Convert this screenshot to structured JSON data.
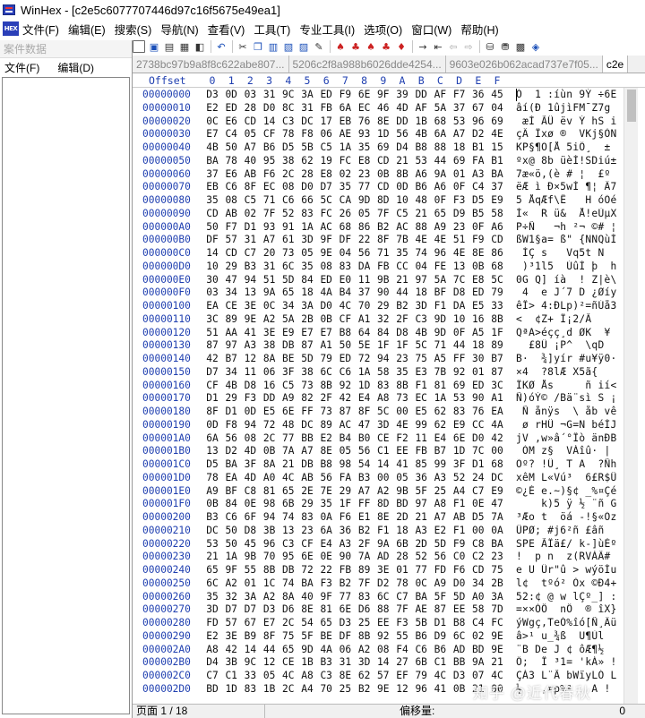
{
  "window": {
    "title": "WinHex - [c2e5c6077707446d97c16f5675e49ea1]",
    "logo_text": "HEX"
  },
  "menu": [
    "文件(F)",
    "编辑(E)",
    "搜索(S)",
    "导航(N)",
    "查看(V)",
    "工具(T)",
    "专业工具(I)",
    "选项(O)",
    "窗口(W)",
    "帮助(H)"
  ],
  "case_panel": {
    "title": "案件数据",
    "menu": [
      "文件(F)",
      "编辑(D)"
    ]
  },
  "tabs": [
    {
      "label": "2738bc97b9a8f8c622abe807...",
      "active": false
    },
    {
      "label": "5206c2f8a988b6026dde4254...",
      "active": false
    },
    {
      "label": "9603e026b062acad737e7f05...",
      "active": false
    },
    {
      "label": "c2e",
      "active": true
    }
  ],
  "hex": {
    "offset_label": "Offset",
    "columns": [
      "0",
      "1",
      "2",
      "3",
      "4",
      "5",
      "6",
      "7",
      "8",
      "9",
      "A",
      "B",
      "C",
      "D",
      "E",
      "F"
    ],
    "rows": [
      {
        "addr": "00000000",
        "bytes": "D3 0D 03 31 9C 3A ED F9 6E 9F 39 DD AF F7 36 45",
        "ascii": "Ó  1 :íùn 9Ý ÷6E"
      },
      {
        "addr": "00000010",
        "bytes": "E2 ED 28 D0 8C 31 FB 6A EC 46 4D AF 5A 37 67 04",
        "ascii": "âí(Ð 1ûjìFM¯Z7g "
      },
      {
        "addr": "00000020",
        "bytes": "0C E6 CD 14 C3 DC 17 EB 76 8E DD 1B 68 53 96 69",
        "ascii": " æÍ ÃÜ ëv Ý hS i"
      },
      {
        "addr": "00000030",
        "bytes": "E7 C4 05 CF 78 F8 06 AE 93 1D 56 4B 6A A7 D2 4E",
        "ascii": "çÄ Ïxø ®  VKj§ÒN"
      },
      {
        "addr": "00000040",
        "bytes": "4B 50 A7 B6 D5 5B C5 1A 35 69 D4 B8 88 18 B1 15",
        "ascii": "KP§¶Õ[Å 5iÔ¸  ± "
      },
      {
        "addr": "00000050",
        "bytes": "BA 78 40 95 38 62 19 FC E8 CD 21 53 44 69 FA B1",
        "ascii": "ºx@ 8b üèÍ!SDiú±"
      },
      {
        "addr": "00000060",
        "bytes": "37 E6 AB F6 2C 28 E8 02 23 0B 8B A6 9A 01 A3 BA",
        "ascii": "7æ«ö,(è # ¦  £º"
      },
      {
        "addr": "00000070",
        "bytes": "EB C6 8F EC 08 D0 D7 35 77 CD 0D B6 A6 0F C4 37",
        "ascii": "ëÆ ì Ð×5wÍ ¶¦ Ä7"
      },
      {
        "addr": "00000080",
        "bytes": "35 08 C5 71 C6 66 5C CA 9D 8D 10 48 0F F3 D5 E9",
        "ascii": "5 ÅqÆf\\Ê   H óÕé"
      },
      {
        "addr": "00000090",
        "bytes": "CD AB 02 7F 52 83 FC 26 05 7F C5 21 65 D9 B5 58",
        "ascii": "Í«  R ü&  Å!eÙµX"
      },
      {
        "addr": "000000A0",
        "bytes": "50 F7 D1 93 91 1A AC 68 86 B2 AC 88 A9 23 0F A6",
        "ascii": "P÷Ñ   ¬h ²¬ ©# ¦"
      },
      {
        "addr": "000000B0",
        "bytes": "DF 57 31 A7 61 3D 9F DF 22 8F 7B 4E 4E 51 F9 CD",
        "ascii": "ßW1§a= ß\" {NNQùÍ"
      },
      {
        "addr": "000000C0",
        "bytes": "14 CD C7 20 73 05 9E 04 56 71 35 74 96 4E 8E 86",
        "ascii": " ÍÇ s   Vq5t N  "
      },
      {
        "addr": "000000D0",
        "bytes": "10 29 B3 31 6C 35 08 83 DA FB CC 04 FE 13 0B 68",
        "ascii": " )³1l5  ÚûÌ þ  h"
      },
      {
        "addr": "000000E0",
        "bytes": "30 47 94 51 5D 84 ED E0 11 9B 21 97 5A 7C E8 5C",
        "ascii": "0G Q] íà  ! Z|è\\"
      },
      {
        "addr": "000000F0",
        "bytes": "03 34 13 9A 65 18 4A B4 37 90 44 18 BF D8 ED 79",
        "ascii": " 4  e J´7 D ¿Øíy"
      },
      {
        "addr": "00000100",
        "bytes": "EA CE 3E 0C 34 3A D0 4C 70 29 B2 3D F1 DA E5 33",
        "ascii": "êÎ> 4:ÐLp)²=ñÚå3"
      },
      {
        "addr": "00000110",
        "bytes": "3C 89 9E A2 5A 2B 0B CF A1 32 2F C3 9D 10 16 8B",
        "ascii": "<  ¢Z+ Ï¡2/Ã    "
      },
      {
        "addr": "00000120",
        "bytes": "51 AA 41 3E E9 E7 E7 B8 64 84 D8 4B 9D 0F A5 1F",
        "ascii": "QªA>éçç¸d ØK  ¥ "
      },
      {
        "addr": "00000130",
        "bytes": "87 97 A3 38 DB 87 A1 50 5E 1F 1F 5C 71 44 18 89",
        "ascii": "  £8Û ¡P^  \\qD  "
      },
      {
        "addr": "00000140",
        "bytes": "42 B7 12 8A BE 5D 79 ED 72 94 23 75 A5 FF 30 B7",
        "ascii": "B·  ¾]yír #u¥ÿ0·"
      },
      {
        "addr": "00000150",
        "bytes": "D7 34 11 06 3F 38 6C C6 1A 58 35 E3 7B 92 01 87",
        "ascii": "×4  ?8lÆ X5ã{   "
      },
      {
        "addr": "00000160",
        "bytes": "CF 4B D8 16 C5 73 8B 92 1D 83 8B F1 81 69 ED 3C",
        "ascii": "ÏKØ Ås     ñ ií<"
      },
      {
        "addr": "00000170",
        "bytes": "D1 29 F3 DD A9 82 2F 42 E4 A8 73 EC 1A 53 90 A1",
        "ascii": "Ñ)óÝ© /Bä¨sì S ¡"
      },
      {
        "addr": "00000180",
        "bytes": "8F D1 0D E5 6E FF 73 87 8F 5C 00 E5 62 83 76 EA",
        "ascii": " Ñ ånÿs  \\ åb vê"
      },
      {
        "addr": "00000190",
        "bytes": "0D F8 94 72 48 DC 89 AC 47 3D 4E 99 62 E9 CC 4A",
        "ascii": " ø rHÜ ¬G=N béÌJ"
      },
      {
        "addr": "000001A0",
        "bytes": "6A 56 08 2C 77 BB E2 B4 B0 CE F2 11 E4 6E D0 42",
        "ascii": "jV ,w»â´°Îò änÐB"
      },
      {
        "addr": "000001B0",
        "bytes": "13 D2 4D 0B 7A A7 8E 05 56 C1 EE FB B7 1D 7C 00",
        "ascii": " ÒM z§  VÁîû· | "
      },
      {
        "addr": "000001C0",
        "bytes": "D5 BA 3F 8A 21 DB B8 98 54 14 41 85 99 3F D1 68",
        "ascii": "Õº? !Û¸ T A  ?Ñh"
      },
      {
        "addr": "000001D0",
        "bytes": "78 EA 4D A0 4C AB 56 FA B3 00 05 36 A3 52 24 DC",
        "ascii": "xêM L«Vú³  6£R$Ü"
      },
      {
        "addr": "000001E0",
        "bytes": "A9 BF C8 81 65 2E 7E 29 A7 A2 9B 5F 25 A4 C7 E9",
        "ascii": "©¿È e.~)§¢ _%¤Çé"
      },
      {
        "addr": "000001F0",
        "bytes": "0B 84 0E 98 6B 29 35 1F FF 8D BD 97 A8 F1 0E 47",
        "ascii": "    k)5 ÿ ½ ¨ñ G"
      },
      {
        "addr": "00000200",
        "bytes": "B3 C6 6F 94 74 83 0A F6 E1 8E 2D 21 A7 AB D5 7A",
        "ascii": "³Æo t  öá -!§«Õz"
      },
      {
        "addr": "00000210",
        "bytes": "DC 50 D8 3B 13 23 6A 36 B2 F1 18 A3 E2 F1 00 0A",
        "ascii": "ÜPØ; #j6²ñ £âñ  "
      },
      {
        "addr": "00000220",
        "bytes": "53 50 45 96 C3 CF E4 A3 2F 9A 6B 2D 5D F9 C8 BA",
        "ascii": "SPE ÃÏä£/ k-]ùÈº"
      },
      {
        "addr": "00000230",
        "bytes": "21 1A 9B 70 95 6E 0E 90 7A AD 28 52 56 C0 C2 23",
        "ascii": "!  p n  z­(RVÀÂ#"
      },
      {
        "addr": "00000240",
        "bytes": "65 9F 55 8B DB 72 22 FB 89 3E 01 77 FD F6 CD 75",
        "ascii": "e U Ûr\"û > wýöÍu"
      },
      {
        "addr": "00000250",
        "bytes": "6C A2 01 1C 74 BA F3 B2 7F D2 78 0C A9 D0 34 2B",
        "ascii": "l¢  tºó² Òx ©Ð4+"
      },
      {
        "addr": "00000260",
        "bytes": "35 32 3A A2 8A 40 9F 77 83 6C C7 BA 5F 5D A0 3A",
        "ascii": "52:¢ @ w lÇº_] :"
      },
      {
        "addr": "00000270",
        "bytes": "3D D7 D7 D3 D6 8E 81 6E D6 88 7F AE 87 EE 58 7D",
        "ascii": "=××ÓÖ  nÖ  ® îX}"
      },
      {
        "addr": "00000280",
        "bytes": "FD 57 67 E7 2C 54 65 D3 25 EE F3 5B D1 B8 C4 FC",
        "ascii": "ýWgç,TeÓ%îó[Ñ¸Äü"
      },
      {
        "addr": "00000290",
        "bytes": "E2 3E B9 8F 75 5F BE DF 8B 92 55 B6 D9 6C 02 9E",
        "ascii": "â>¹ u_¾ß  U¶Ùl  "
      },
      {
        "addr": "000002A0",
        "bytes": "A8 42 14 44 65 9D 4A 06 A2 08 F4 C6 B6 AD BD 9E",
        "ascii": "¨B De J ¢ ôÆ¶­½ "
      },
      {
        "addr": "000002B0",
        "bytes": "D4 3B 9C 12 CE 1B B3 31 3D 14 27 6B C1 BB 9A 21",
        "ascii": "Ô;  Î ³1= 'kÁ» !"
      },
      {
        "addr": "000002C0",
        "bytes": "C7 C1 33 05 4C A8 C3 8E 62 57 EF 79 4C D3 07 4C",
        "ascii": "ÇÁ3 L¨Ã bWïyLÓ L"
      },
      {
        "addr": "000002D0",
        "bytes": "BD 1D 83 1B 2C A4 70 25 B2 9E 12 96 41 0B 21 00",
        "ascii": "½   ,¤p%²   A ! "
      }
    ]
  },
  "status": {
    "page": "页面 1 / 18",
    "offset_label": "偏移量:",
    "value": "0"
  },
  "watermark": "知乎 @近代春秋"
}
